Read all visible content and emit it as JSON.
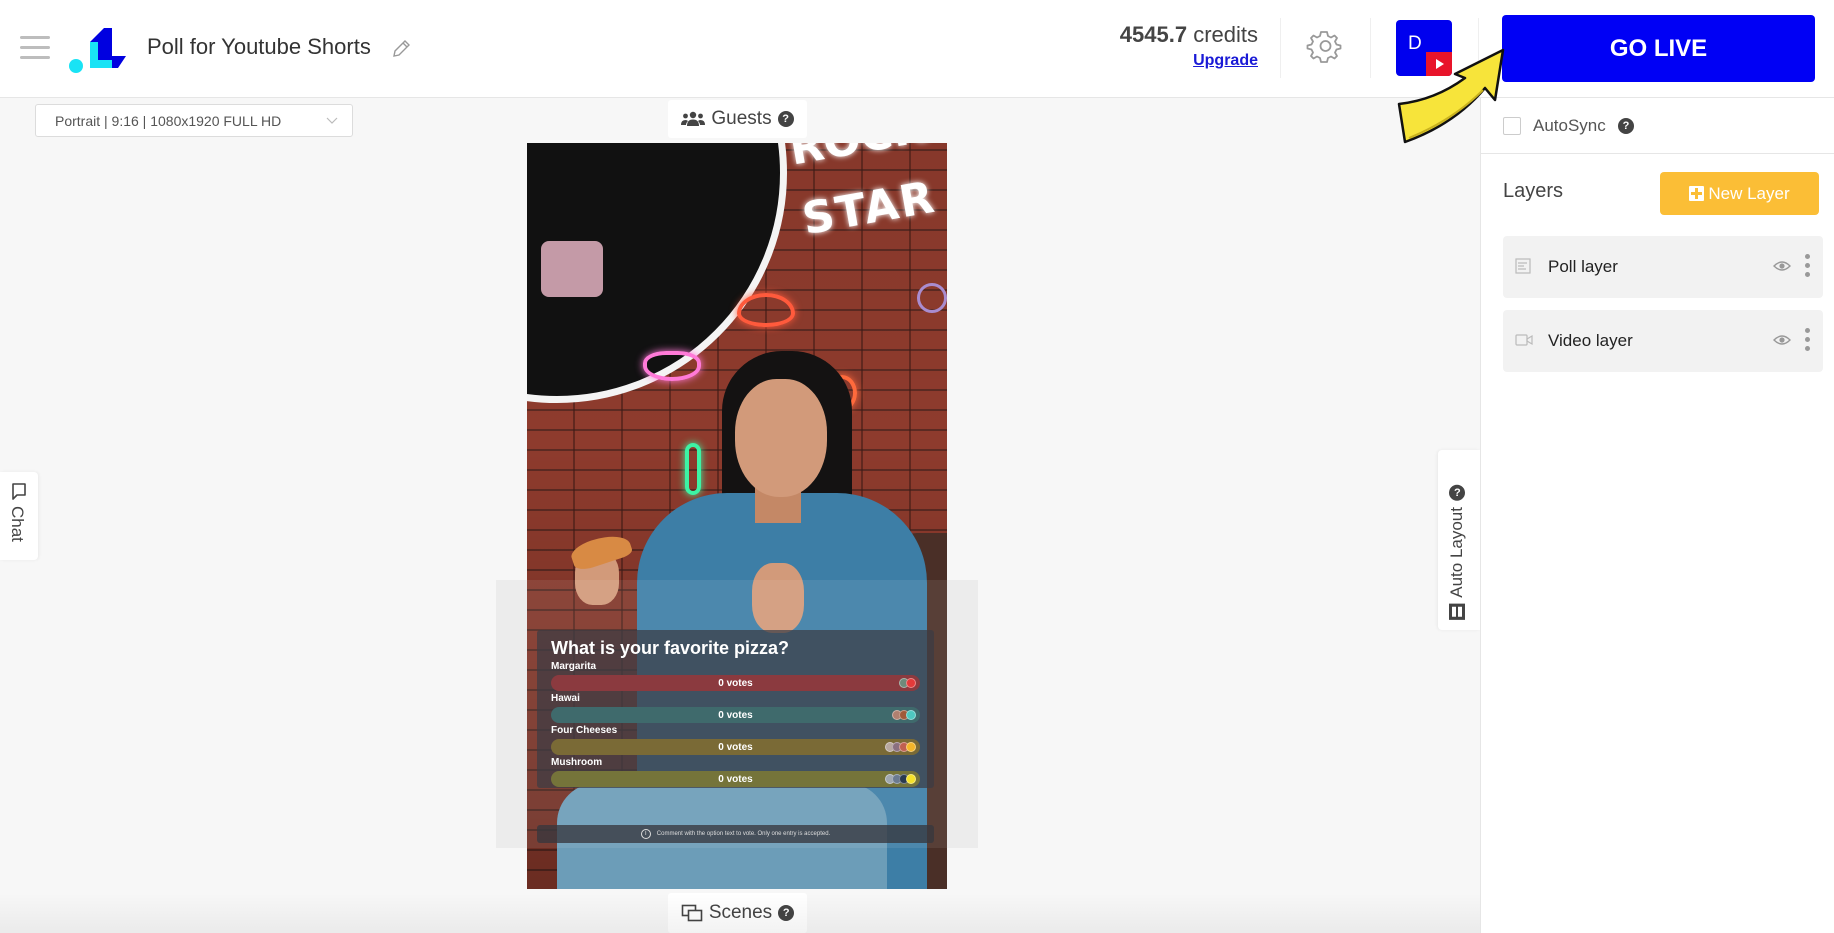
{
  "header": {
    "title": "Poll for Youtube Shorts",
    "credits_value": "4545.7",
    "credits_unit": "credits",
    "upgrade_label": "Upgrade",
    "avatar_letter": "D",
    "go_live_label": "GO LIVE"
  },
  "canvas": {
    "format_select_value": "Portrait | 9:16 | 1080x1920 FULL HD",
    "guests_label": "Guests",
    "scenes_label": "Scenes",
    "chat_label": "Chat",
    "auto_layout_label": "Auto Layout",
    "help_glyph": "?"
  },
  "video": {
    "neon_text_top": "ROCK",
    "neon_text": "STAR"
  },
  "poll": {
    "question": "What is your favorite pizza?",
    "options": [
      {
        "label": "Margarita",
        "votes": "0 votes",
        "color": "#8b3a3f"
      },
      {
        "label": "Hawai",
        "votes": "0 votes",
        "color": "#3f6a6c"
      },
      {
        "label": "Four Cheeses",
        "votes": "0 votes",
        "color": "#7a6a36"
      },
      {
        "label": "Mushroom",
        "votes": "0 votes",
        "color": "#75743a"
      }
    ],
    "note": "Comment with the option text to vote. Only one entry is accepted.",
    "info_glyph": "i"
  },
  "right_panel": {
    "autosync_label": "AutoSync",
    "autosync_checked": false,
    "layers_title": "Layers",
    "new_layer_label": "New Layer",
    "layers": [
      {
        "name": "Poll layer",
        "icon": "poll-icon",
        "visible": true
      },
      {
        "name": "Video layer",
        "icon": "video-camera-icon",
        "visible": true
      }
    ]
  },
  "colors": {
    "brand_blue": "#0000f5",
    "accent_yellow": "#fbbe36",
    "link_blue": "#1a1ad6",
    "youtube_red": "#e8142a"
  }
}
